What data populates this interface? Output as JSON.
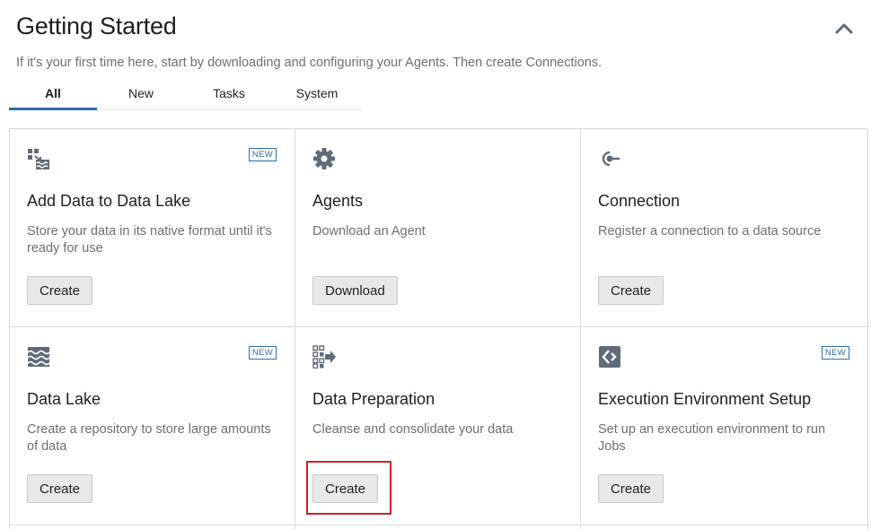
{
  "header": {
    "title": "Getting Started",
    "subtitle": "If it's your first time here, start by downloading and configuring your Agents. Then create Connections."
  },
  "tabs": [
    {
      "label": "All",
      "active": true
    },
    {
      "label": "New",
      "active": false
    },
    {
      "label": "Tasks",
      "active": false
    },
    {
      "label": "System",
      "active": false
    }
  ],
  "cards": [
    {
      "icon": "data-lake-add-icon",
      "badge": "NEW",
      "title": "Add Data to Data Lake",
      "description": "Store your data in its native format until it's ready for use",
      "button": "Create"
    },
    {
      "icon": "gear-icon",
      "badge": "",
      "title": "Agents",
      "description": "Download an Agent",
      "button": "Download"
    },
    {
      "icon": "connection-icon",
      "badge": "",
      "title": "Connection",
      "description": "Register a connection to a data source",
      "button": "Create"
    },
    {
      "icon": "waves-icon",
      "badge": "NEW",
      "title": "Data Lake",
      "description": "Create a repository to store large amounts of data",
      "button": "Create"
    },
    {
      "icon": "data-prep-icon",
      "badge": "",
      "title": "Data Preparation",
      "description": "Cleanse and consolidate your data",
      "button": "Create"
    },
    {
      "icon": "execution-env-icon",
      "badge": "NEW",
      "title": "Execution Environment Setup",
      "description": "Set up an execution environment to run Jobs",
      "button": "Create"
    }
  ],
  "colors": {
    "accent": "#2e6ea8",
    "icon": "#5f6b78",
    "highlight": "#d0212a",
    "button_bg": "#e6e8ea"
  }
}
